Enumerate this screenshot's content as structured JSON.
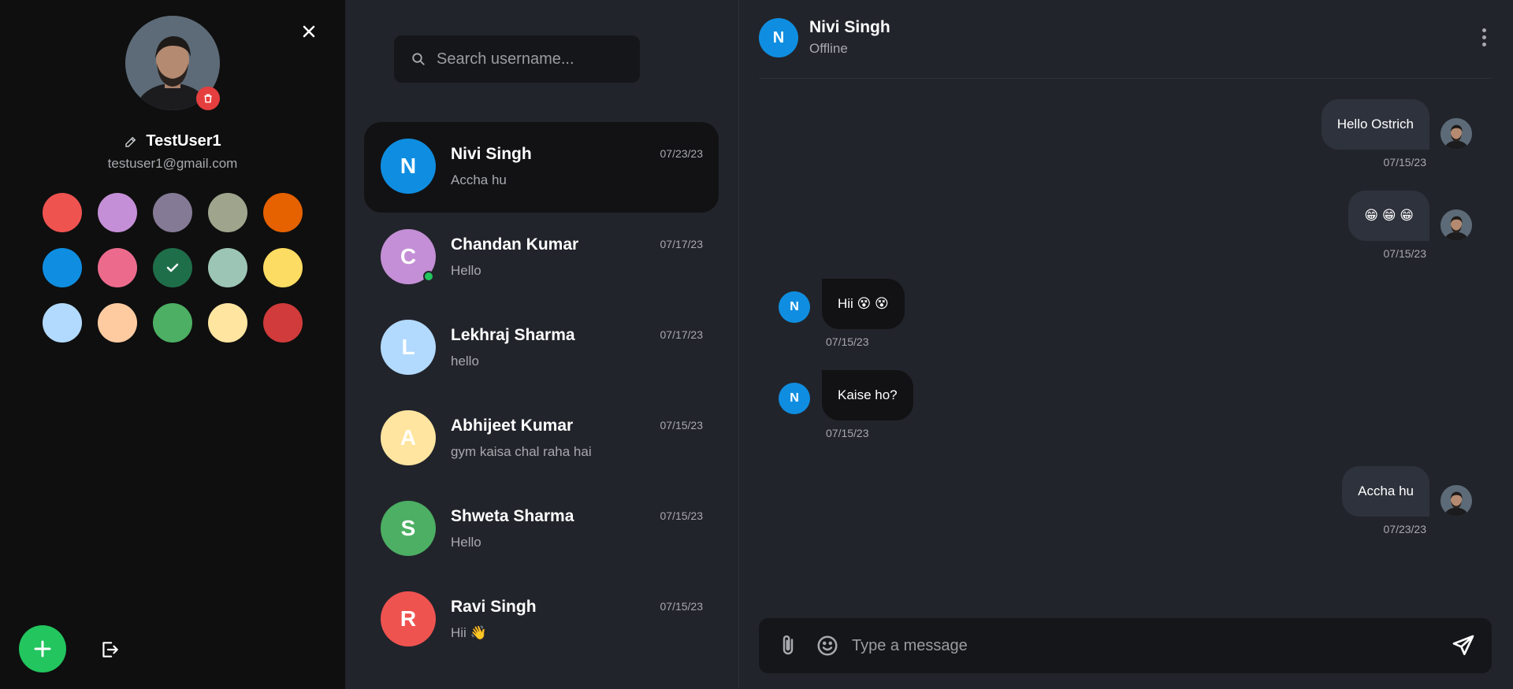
{
  "profile": {
    "username": "TestUser1",
    "email": "testuser1@gmail.com",
    "icons": [
      "close-icon",
      "trash-icon",
      "edit-icon",
      "plus-icon",
      "logout-icon",
      "check-icon"
    ],
    "swatches": [
      "#ef5350",
      "#c48fd6",
      "#857a95",
      "#9fa58d",
      "#e66100",
      "#0f8ee1",
      "#ec6b8d",
      "#1f6e4a",
      "#9cc5b6",
      "#fcdc62",
      "#b2daff",
      "#fecba1",
      "#4caf63",
      "#ffe5a0",
      "#d13b3b"
    ],
    "selected_swatch": "#1f6e4a"
  },
  "search": {
    "placeholder": "Search username..."
  },
  "contacts": [
    {
      "initial": "N",
      "name": "Nivi Singh",
      "last_message": "Accha hu",
      "date": "07/23/23",
      "color": "#0f8ee1",
      "active": true,
      "online": false
    },
    {
      "initial": "C",
      "name": "Chandan Kumar",
      "last_message": "Hello",
      "date": "07/17/23",
      "color": "#c48fd6",
      "active": false,
      "online": true
    },
    {
      "initial": "L",
      "name": "Lekhraj Sharma",
      "last_message": "hello",
      "date": "07/17/23",
      "color": "#b2daff",
      "active": false,
      "online": false
    },
    {
      "initial": "A",
      "name": "Abhijeet Kumar",
      "last_message": "gym kaisa chal raha hai",
      "date": "07/15/23",
      "color": "#ffe5a0",
      "active": false,
      "online": false
    },
    {
      "initial": "S",
      "name": "Shweta Sharma",
      "last_message": "Hello",
      "date": "07/15/23",
      "color": "#4caf63",
      "active": false,
      "online": false
    },
    {
      "initial": "R",
      "name": "Ravi Singh",
      "last_message": "Hii 👋",
      "date": "07/15/23",
      "color": "#ef5350",
      "active": false,
      "online": false
    }
  ],
  "chat": {
    "initial": "N",
    "name": "Nivi Singh",
    "status": "Offline",
    "messages": [
      {
        "direction": "out",
        "text": "Hello Ostrich",
        "date": "07/15/23"
      },
      {
        "direction": "out",
        "text": "😁 😁 😁",
        "date": "07/15/23"
      },
      {
        "direction": "in",
        "text": "Hii 😵 😵",
        "date": "07/15/23"
      },
      {
        "direction": "in",
        "text": "Kaise ho?",
        "date": "07/15/23"
      },
      {
        "direction": "out",
        "text": "Accha hu",
        "date": "07/23/23"
      }
    ],
    "composer_placeholder": "Type a message"
  },
  "colors": {
    "online": "#22c55e",
    "delete": "#e53e3e",
    "add_button": "#22c55e"
  }
}
